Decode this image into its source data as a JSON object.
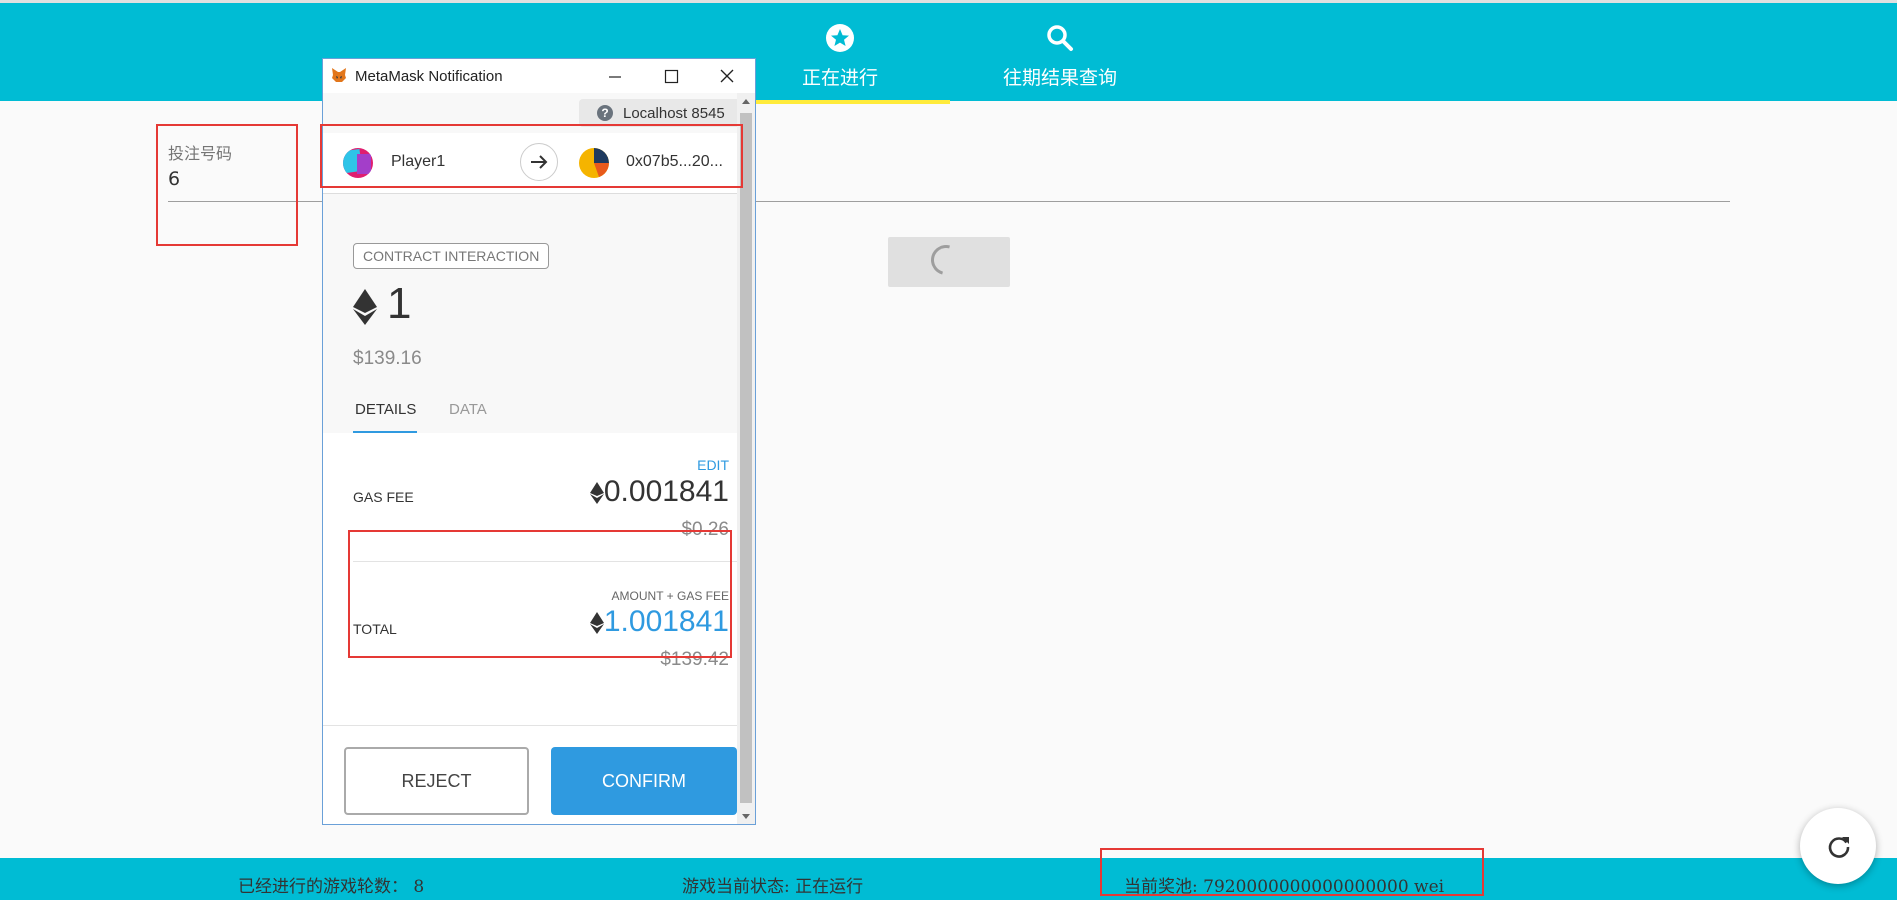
{
  "app": {
    "tabs": [
      {
        "label": "正在进行",
        "icon": "star-circle-icon",
        "active": true
      },
      {
        "label": "往期结果查询",
        "icon": "search-icon",
        "active": false
      }
    ],
    "form": {
      "bet_label": "投注号码",
      "bet_value": "6"
    },
    "footer": {
      "rounds": "已经进行的游戏轮数： 8",
      "status": "游戏当前状态: 正在运行",
      "pool": "当前奖池: 7920000000000000000 wei"
    },
    "refresh_icon": "refresh-icon"
  },
  "metamask": {
    "window_title": "MetaMask Notification",
    "network": "Localhost 8545",
    "from_account": "Player1",
    "to_address": "0x07b5...20...",
    "badge": "CONTRACT INTERACTION",
    "amount_eth": "1",
    "amount_usd": "$139.16",
    "tabs": [
      "DETAILS",
      "DATA"
    ],
    "edit_label": "EDIT",
    "gas_fee_label": "GAS FEE",
    "gas_fee_eth": "0.001841",
    "gas_fee_usd": "$0.26",
    "total_caption": "AMOUNT + GAS FEE",
    "total_label": "TOTAL",
    "total_eth": "1.001841",
    "total_usd": "$139.42",
    "reject_label": "REJECT",
    "confirm_label": "CONFIRM"
  },
  "colors": {
    "app_primary": "#00bcd4",
    "tab_indicator": "#ffeb3b",
    "metamask_blue": "#2f9ae0",
    "highlight_red": "#e53935"
  }
}
